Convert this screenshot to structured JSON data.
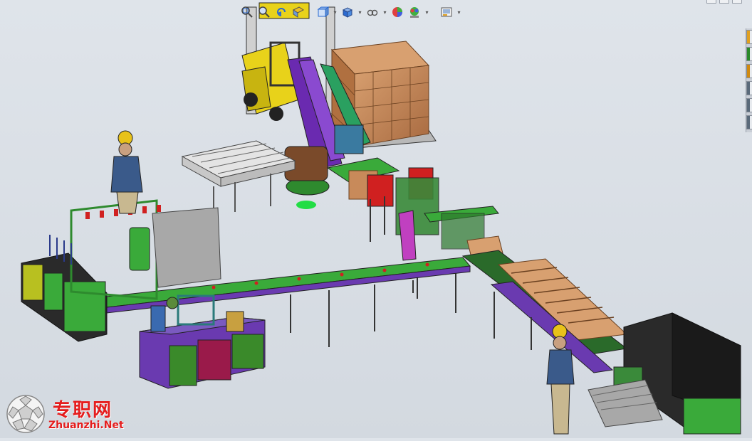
{
  "heads_up_toolbar": {
    "tools": [
      {
        "icon": "zoom-to-fit-icon"
      },
      {
        "icon": "zoom-to-area-icon"
      },
      {
        "icon": "previous-view-icon"
      },
      {
        "icon": "section-view-icon"
      },
      {
        "icon": "view-orientation-icon",
        "dropdown": true
      },
      {
        "icon": "display-style-icon",
        "dropdown": true
      },
      {
        "icon": "hide-show-items-icon",
        "dropdown": true
      },
      {
        "icon": "edit-appearance-icon"
      },
      {
        "icon": "apply-scene-icon",
        "dropdown": true
      },
      {
        "icon": "view-settings-icon",
        "dropdown": true
      }
    ]
  },
  "task_pane": {
    "tabs": [
      {
        "icon": "resources-icon",
        "color": "#e0a020"
      },
      {
        "icon": "design-library-icon",
        "color": "#2a8a2a"
      },
      {
        "icon": "file-explorer-icon",
        "color": "#d08a10"
      },
      {
        "icon": "view-palette-icon",
        "color": "#5a6a7a"
      },
      {
        "icon": "appearances-icon",
        "color": "#5a6a7a"
      },
      {
        "icon": "custom-properties-icon",
        "color": "#5a6a7a"
      }
    ]
  },
  "watermark": {
    "title": "专职网",
    "url": "Zhuanzhi.Net"
  },
  "colors": {
    "background": "#d8dde3",
    "brand_red": "#e51d1d",
    "forklift_yellow": "#e8d21a",
    "box_cardboard": "#c88a5a",
    "conveyor_green": "#2e9a2e",
    "robot_purple": "#6a2ab0"
  }
}
